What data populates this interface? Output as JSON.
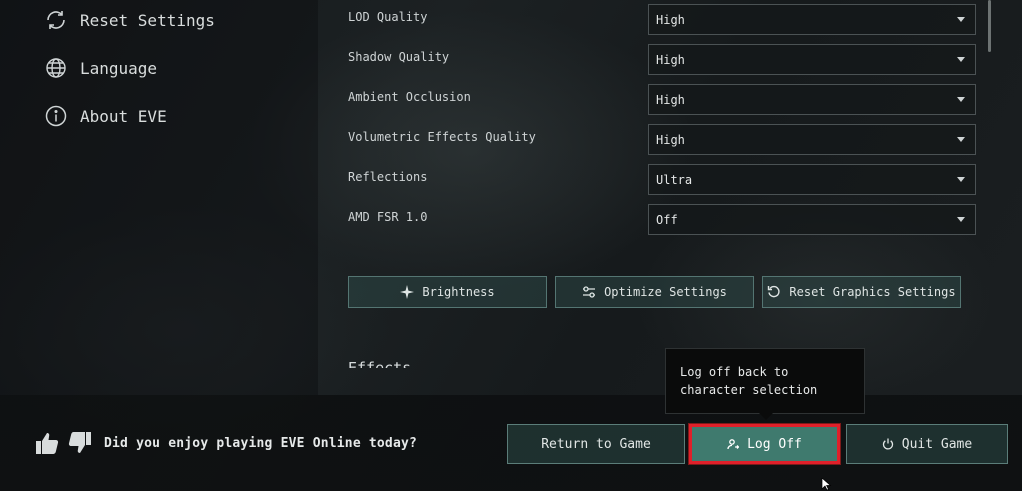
{
  "sidebar": {
    "items": [
      {
        "label": "Reset Settings",
        "icon": "reset-icon"
      },
      {
        "label": "Language",
        "icon": "globe-icon"
      },
      {
        "label": "About EVE",
        "icon": "info-icon"
      }
    ]
  },
  "graphics": {
    "rows": [
      {
        "label": "LOD Quality",
        "value": "High"
      },
      {
        "label": "Shadow Quality",
        "value": "High"
      },
      {
        "label": "Ambient Occlusion",
        "value": "High"
      },
      {
        "label": "Volumetric Effects Quality",
        "value": "High"
      },
      {
        "label": "Reflections",
        "value": "Ultra"
      },
      {
        "label": "AMD FSR 1.0",
        "value": "Off"
      }
    ],
    "buttons": {
      "brightness": "Brightness",
      "optimize": "Optimize Settings",
      "reset": "Reset Graphics Settings"
    },
    "next_section_heading": "Effects"
  },
  "footer": {
    "feedback_question": "Did you enjoy playing EVE Online today?",
    "return_label": "Return to Game",
    "logoff_label": "Log Off",
    "quit_label": "Quit Game"
  },
  "tooltip": {
    "text": "Log off back to character selection"
  },
  "colors": {
    "accent_teal": "#3f7a6e",
    "highlight_red": "#e0202a",
    "panel_border": "#4b5254"
  }
}
